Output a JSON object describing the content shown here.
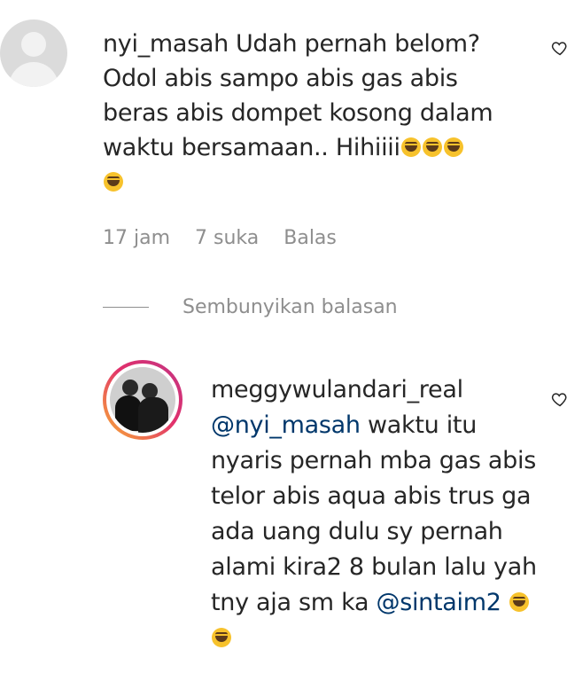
{
  "comment": {
    "username": "nyi_masah",
    "text": "Udah pernah belom? Odol abis sampo abis gas abis beras abis dompet kosong dalam waktu bersamaan.. Hihiiii",
    "emojis": [
      "laughing-emoji",
      "laughing-emoji",
      "laughing-emoji",
      "laughing-emoji"
    ],
    "time": "17 jam",
    "likes": "7 suka",
    "reply_label": "Balas"
  },
  "replies_toggle": {
    "label": "Sembunyikan balasan"
  },
  "reply": {
    "username": "meggywulandari_real",
    "mention": "@nyi_masah",
    "text": "waktu itu nyaris pernah mba gas abis telor abis aqua abis trus ga ada uang dulu sy pernah alami kira2 8 bulan lalu yah tny aja sm ka",
    "mention2": "@sintaim2",
    "emojis": [
      "grinning-emoji",
      "laughing-emoji"
    ]
  },
  "colors": {
    "text": "#262626",
    "secondary": "#8e8e8e",
    "mention": "#00376b",
    "story_ring_start": "#f9b233",
    "story_ring_end": "#c13584"
  }
}
